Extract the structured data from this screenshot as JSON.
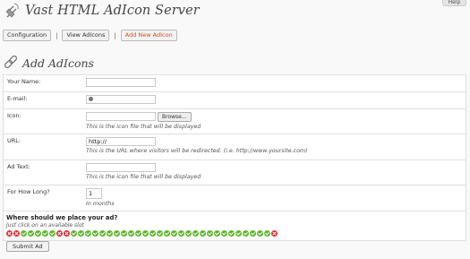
{
  "help_tab": "Help",
  "header": {
    "title": "Vast HTML AdIcon Server"
  },
  "nav": {
    "configuration": "Configuration",
    "separator": "|",
    "view_adicons": "View AdIcons",
    "add_new_adicon": "Add New AdIcon"
  },
  "section": {
    "title": "Add AdIcons"
  },
  "form": {
    "name_label": "Your Name:",
    "name_value": "",
    "email_label": "E-mail:",
    "icon_label": "Icon:",
    "browse_label": "Browse...",
    "icon_note": "This is the icon file that will be displayed",
    "url_label": "URL:",
    "url_value": "http://",
    "url_note": "This is the URL where visitors will be redirected. (i.e. http://www.yoursite.com)",
    "adtext_label": "Ad Text:",
    "adtext_note": "This is the icon file that will be displayed",
    "howlong_label": "For How Long?",
    "howlong_value": "1",
    "howlong_note": "In months",
    "place_question": "Where should we place your ad?",
    "place_hint": "Just click on an available slot",
    "submit_label": "Submit Ad"
  },
  "slots": [
    "taken",
    "taken",
    "free",
    "free",
    "free",
    "free",
    "free",
    "taken",
    "taken",
    "free",
    "free",
    "free",
    "free",
    "free",
    "free",
    "free",
    "free",
    "free",
    "free",
    "free",
    "free",
    "free",
    "free",
    "free",
    "free",
    "free",
    "free",
    "free",
    "free",
    "free",
    "free",
    "free",
    "free",
    "free",
    "free",
    "free",
    "free",
    "taken"
  ],
  "colors": {
    "slot_free": "#5fb52e",
    "slot_taken": "#d9262b",
    "active_link": "#d54e21"
  }
}
